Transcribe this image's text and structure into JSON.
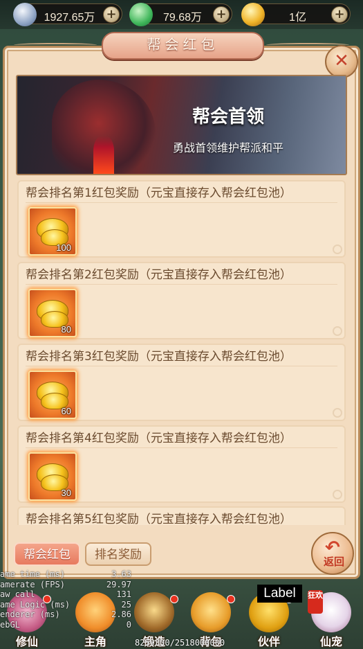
{
  "currency": [
    {
      "icon": "silver-ingot-icon",
      "value": "1927.65万"
    },
    {
      "icon": "jade-icon",
      "value": "79.68万"
    },
    {
      "icon": "gold-ingot-icon",
      "value": "1亿"
    }
  ],
  "currency_plus": "+",
  "panel": {
    "title": "帮会红包",
    "close_icon": "✕",
    "banner_title": "帮会首领",
    "banner_subtitle": "勇战首领维护帮派和平"
  },
  "rewards": [
    {
      "title": "帮会排名第1红包奖励（元宝直接存入帮会红包池）",
      "count": "100"
    },
    {
      "title": "帮会排名第2红包奖励（元宝直接存入帮会红包池）",
      "count": "80"
    },
    {
      "title": "帮会排名第3红包奖励（元宝直接存入帮会红包池）",
      "count": "60"
    },
    {
      "title": "帮会排名第4红包奖励（元宝直接存入帮会红包池）",
      "count": "30"
    },
    {
      "title": "帮会排名第5红包奖励（元宝直接存入帮会红包池）",
      "count": ""
    }
  ],
  "tabs": {
    "guild_redpacket": "帮会红包",
    "rank_reward": "排名奖励"
  },
  "back": {
    "arrow": "↶",
    "label": "返回"
  },
  "debug": [
    {
      "k": "ame time (ms)",
      "v": "3.63"
    },
    {
      "k": "amerate (FPS)",
      "v": "29.97"
    },
    {
      "k": "aw call",
      "v": "131"
    },
    {
      "k": "ame Logic (ms)",
      "v": "25"
    },
    {
      "k": "enderer (ms)",
      "v": "2.86"
    },
    {
      "k": "ebGL",
      "v": "0"
    }
  ],
  "memory": "8259300/2518000000",
  "label_box": "Label",
  "crazy_badge": "狂欢",
  "nav": [
    {
      "label": "修仙",
      "dot": true
    },
    {
      "label": "主角",
      "dot": false
    },
    {
      "label": "锻造",
      "dot": true
    },
    {
      "label": "背包",
      "dot": true
    },
    {
      "label": "伙伴",
      "dot": true
    },
    {
      "label": "仙宠",
      "dot": false
    }
  ],
  "colors": {
    "panel_bg": "#f3dcc0",
    "tab_active": "#e77a5f",
    "accent_red": "#d1452c"
  }
}
